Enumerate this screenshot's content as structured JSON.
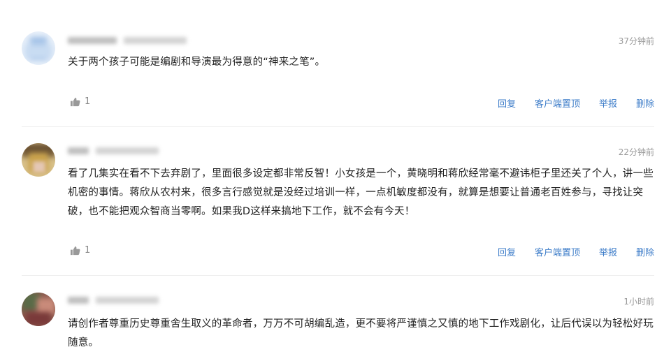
{
  "comments": [
    {
      "time": "37分钟前",
      "text": "关于两个孩子可能是编剧和导演最为得意的“神来之笔”。",
      "likes": "1",
      "avatar_colors": [
        "#c9dcf2",
        "#9fbfe6",
        "#e8f0fa"
      ]
    },
    {
      "time": "22分钟前",
      "text": "看了几集实在看不下去弃剧了，里面很多设定都非常反智！小女孩是一个，黄晓明和蒋欣经常毫不避讳柜子里还关了个人，讲一些机密的事情。蒋欣从农村来，很多言行感觉就是没经过培训一样，一点机敏度都没有，就算是想要让普通老百姓参与，寻找让突破，也不能把观众智商当零啊。如果我D这样来搞地下工作，就不会有今天！",
      "likes": "1",
      "avatar_colors": [
        "#c9a24a",
        "#8a6b3a",
        "#d8c08a"
      ]
    },
    {
      "time": "1小时前",
      "text": "请创作者尊重历史尊重舍生取义的革命者，万万不可胡编乱造，更不要将严谨慎之又慎的地下工作戏剧化，让后代误以为轻松好玩随意。",
      "avatar_colors": [
        "#8c5a4e",
        "#5a6b48",
        "#c98b7a"
      ]
    }
  ],
  "actions": {
    "reply": "回复",
    "pin": "客户端置顶",
    "report": "举报",
    "delete": "删除"
  },
  "colors": {
    "link": "#3e7dc9",
    "time": "#999999",
    "divider": "#eeeeee"
  },
  "icons": {
    "like": "thumbs-up-icon"
  }
}
